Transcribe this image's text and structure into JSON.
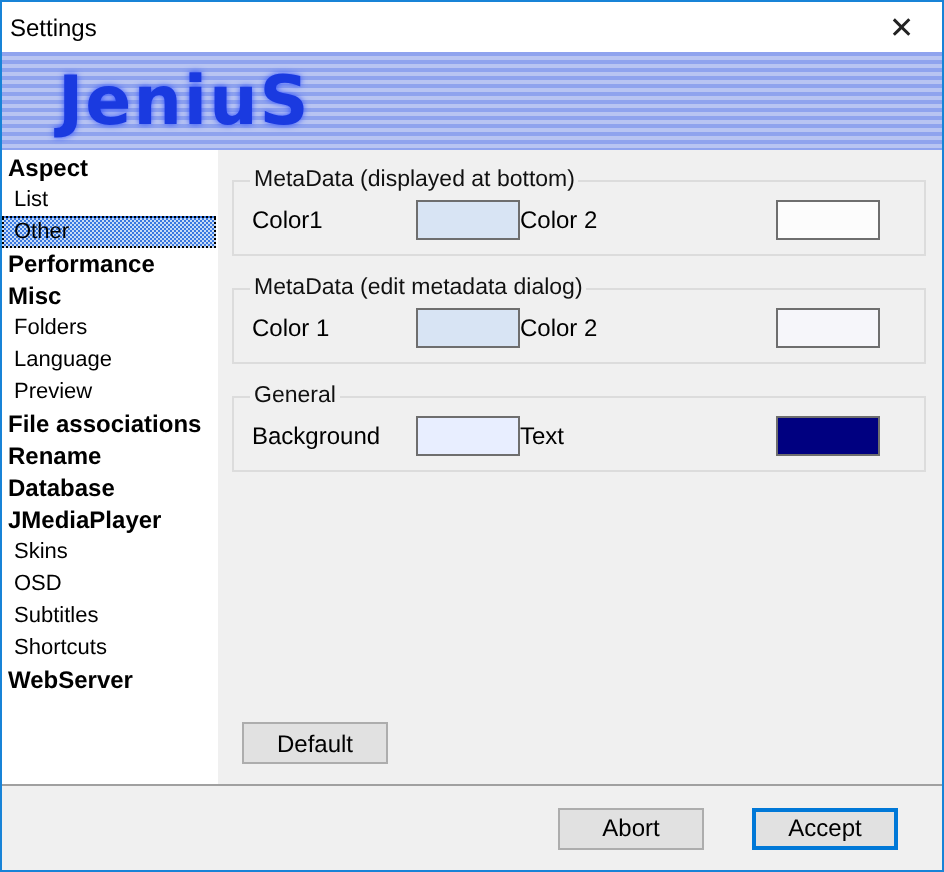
{
  "window": {
    "title": "Settings",
    "close": "✕"
  },
  "banner": {
    "title": "JeniuS"
  },
  "sidebar": {
    "items": [
      {
        "label": "Aspect",
        "selected": false,
        "children": [
          {
            "label": "List",
            "selected": false
          },
          {
            "label": "Other",
            "selected": true
          }
        ]
      },
      {
        "label": "Performance",
        "selected": false
      },
      {
        "label": "Misc",
        "selected": false,
        "children": [
          {
            "label": "Folders",
            "selected": false
          },
          {
            "label": "Language",
            "selected": false
          },
          {
            "label": "Preview",
            "selected": false
          }
        ]
      },
      {
        "label": "File associations",
        "selected": false
      },
      {
        "label": "Rename",
        "selected": false
      },
      {
        "label": "Database",
        "selected": false
      },
      {
        "label": "JMediaPlayer",
        "selected": false,
        "children": [
          {
            "label": "Skins",
            "selected": false
          },
          {
            "label": "OSD",
            "selected": false
          },
          {
            "label": "Subtitles",
            "selected": false
          },
          {
            "label": "Shortcuts",
            "selected": false
          }
        ]
      },
      {
        "label": "WebServer",
        "selected": false
      }
    ]
  },
  "groups": [
    {
      "title": "MetaData (displayed at bottom)",
      "fields": [
        {
          "label": "Color1",
          "color": "#d8e4f4"
        },
        {
          "label": "Color 2",
          "color": "#fcfcfc"
        }
      ]
    },
    {
      "title": "MetaData (edit metadata dialog)",
      "fields": [
        {
          "label": "Color 1",
          "color": "#d8e4f4"
        },
        {
          "label": "Color 2",
          "color": "#f6f6fa"
        }
      ]
    },
    {
      "title": "General",
      "fields": [
        {
          "label": "Background",
          "color": "#e8eeff"
        },
        {
          "label": "Text",
          "color": "#000080"
        }
      ]
    }
  ],
  "default_button": "Default",
  "buttons": [
    {
      "label": "Abort",
      "focused": false
    },
    {
      "label": "Accept",
      "focused": true
    }
  ]
}
